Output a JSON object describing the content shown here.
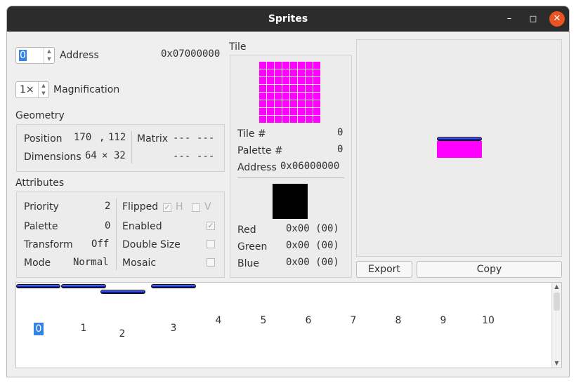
{
  "window": {
    "title": "Sprites"
  },
  "address": {
    "value": "0",
    "label": "Address",
    "hex": "0x07000000"
  },
  "magnification": {
    "value": "1×",
    "label": "Magnification"
  },
  "geometry": {
    "title": "Geometry",
    "position_label": "Position",
    "pos_x": "170",
    "pos_sep": ",",
    "pos_y": "112",
    "dimensions_label": "Dimensions",
    "width": "64",
    "dim_sep": "×",
    "height": "32",
    "matrix_label": "Matrix",
    "matrix": [
      "---",
      "---",
      "---",
      "---"
    ]
  },
  "attributes": {
    "title": "Attributes",
    "priority_label": "Priority",
    "priority": "2",
    "palette_label": "Palette",
    "palette": "0",
    "transform_label": "Transform",
    "transform": "Off",
    "mode_label": "Mode",
    "mode": "Normal",
    "flipped_label": "Flipped",
    "flip_h": "H",
    "flip_v": "V",
    "flip_h_checked": true,
    "flip_v_checked": false,
    "enabled_label": "Enabled",
    "enabled_checked": true,
    "double_size_label": "Double Size",
    "double_size_checked": false,
    "mosaic_label": "Mosaic",
    "mosaic_checked": false
  },
  "tile": {
    "title": "Tile",
    "tile_num_label": "Tile #",
    "tile_num": "0",
    "palette_num_label": "Palette #",
    "palette_num": "0",
    "address_label": "Address",
    "address": "0x06000000",
    "pixel_color": "#ff00ff",
    "swatch_color": "#000000",
    "red_label": "Red",
    "red": "0x00 (00)",
    "green_label": "Green",
    "green": "0x00 (00)",
    "blue_label": "Blue",
    "blue": "0x00 (00)"
  },
  "actions": {
    "export_label": "Export",
    "copy_label": "Copy"
  },
  "sprite_list": {
    "items": [
      "0",
      "1",
      "2",
      "3",
      "4",
      "5",
      "6",
      "7",
      "8",
      "9",
      "10"
    ],
    "selected": "0"
  },
  "colors": {
    "accent": "#3584e4",
    "titlebar": "#2c2c2c",
    "close": "#e95420",
    "sprite_fill": "#ff00ff"
  }
}
